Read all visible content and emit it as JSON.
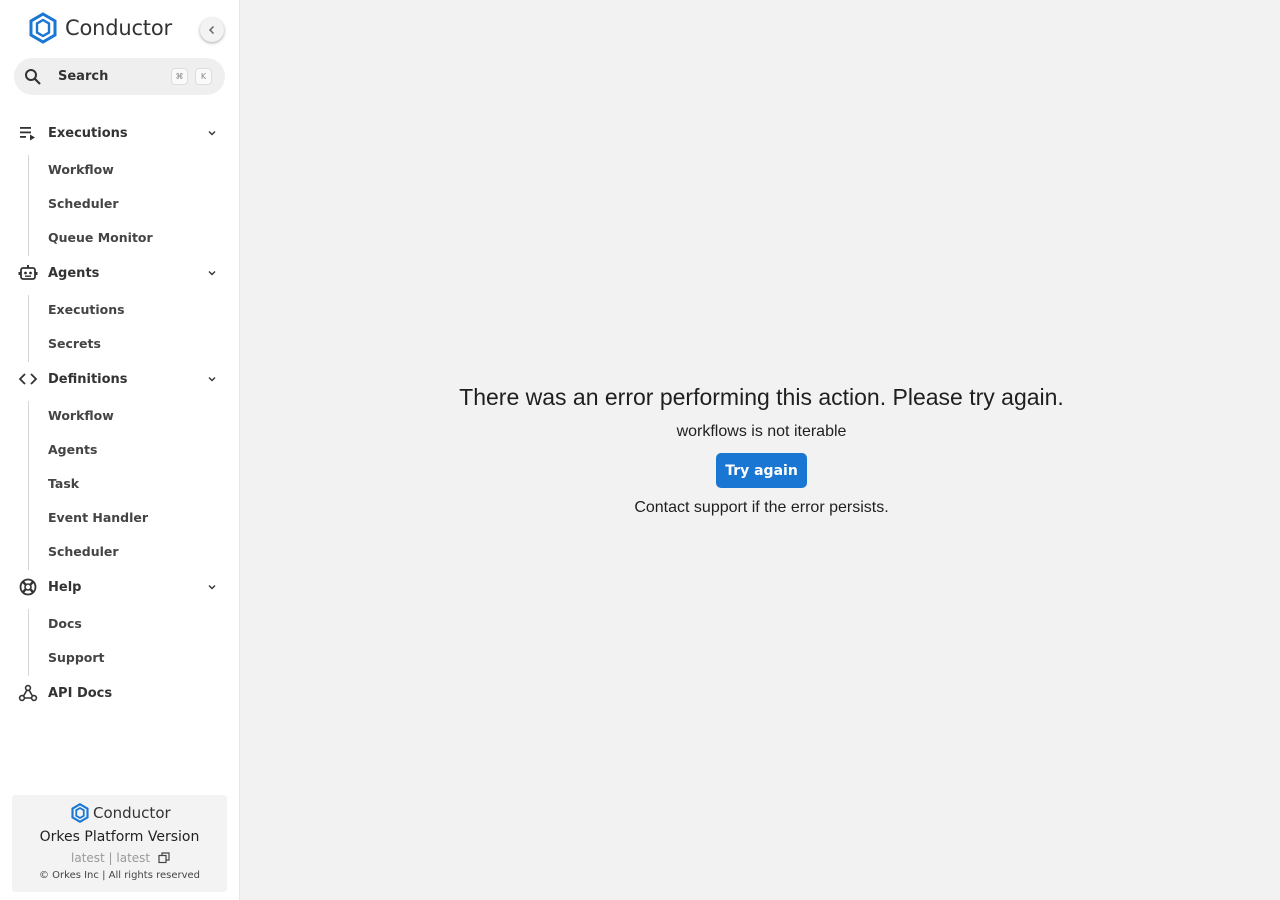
{
  "app": {
    "logo_text": "Conductor",
    "brand_color": "#1976d2"
  },
  "search": {
    "label": "Search",
    "shortcut_mod": "⌘",
    "shortcut_key": "K"
  },
  "nav": {
    "executions": {
      "label": "Executions",
      "items": [
        "Workflow",
        "Scheduler",
        "Queue Monitor"
      ]
    },
    "agents": {
      "label": "Agents",
      "items": [
        "Executions",
        "Secrets"
      ]
    },
    "definitions": {
      "label": "Definitions",
      "items": [
        "Workflow",
        "Agents",
        "Task",
        "Event Handler",
        "Scheduler"
      ]
    },
    "help": {
      "label": "Help",
      "items": [
        "Docs",
        "Support"
      ]
    },
    "api_docs": {
      "label": "API Docs"
    }
  },
  "footer": {
    "logo_text": "Conductor",
    "version_title": "Orkes Platform Version",
    "version": "latest | latest",
    "copyright": "© Orkes Inc | All rights reserved"
  },
  "error": {
    "title": "There was an error performing this action. Please try again.",
    "detail": "workflows is not iterable",
    "button_label": "Try again",
    "contact": "Contact support if the error persists."
  }
}
